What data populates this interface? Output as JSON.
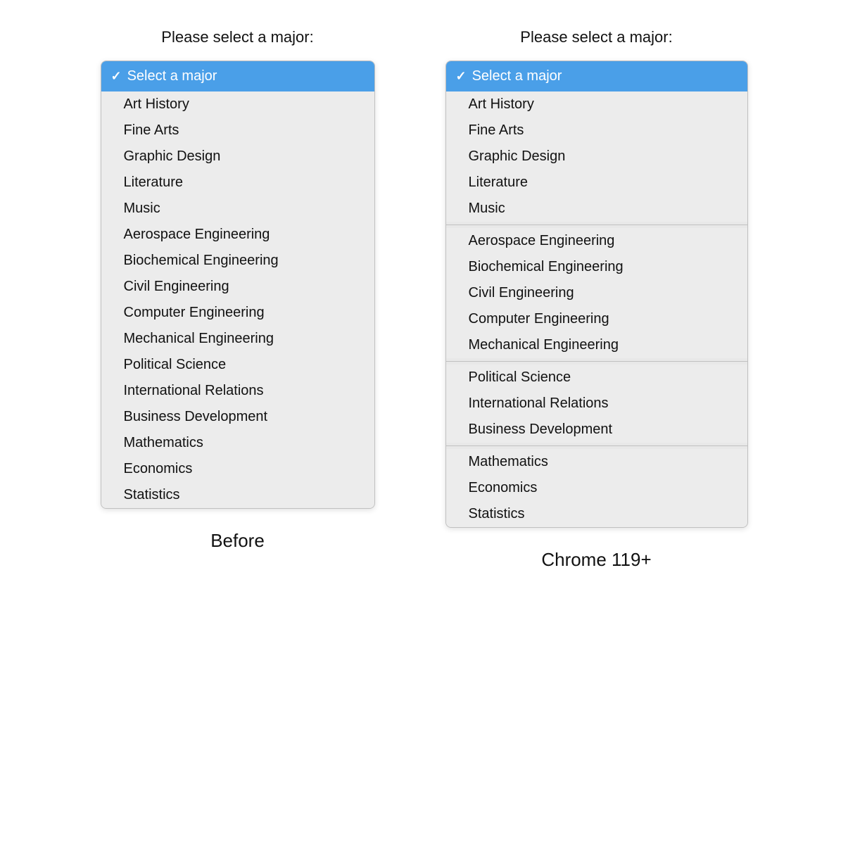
{
  "left": {
    "label": "Please select a major:",
    "caption": "Before",
    "selected": "Select a major",
    "options": [
      "Art History",
      "Fine Arts",
      "Graphic Design",
      "Literature",
      "Music",
      "Aerospace Engineering",
      "Biochemical Engineering",
      "Civil Engineering",
      "Computer Engineering",
      "Mechanical Engineering",
      "Political Science",
      "International Relations",
      "Business Development",
      "Mathematics",
      "Economics",
      "Statistics"
    ]
  },
  "right": {
    "label": "Please select a major:",
    "caption": "Chrome 119+",
    "selected": "Select a major",
    "groups": [
      [
        "Art History",
        "Fine Arts",
        "Graphic Design",
        "Literature",
        "Music"
      ],
      [
        "Aerospace Engineering",
        "Biochemical Engineering",
        "Civil Engineering",
        "Computer Engineering",
        "Mechanical Engineering"
      ],
      [
        "Political Science",
        "International Relations",
        "Business Development"
      ],
      [
        "Mathematics",
        "Economics",
        "Statistics"
      ]
    ]
  }
}
